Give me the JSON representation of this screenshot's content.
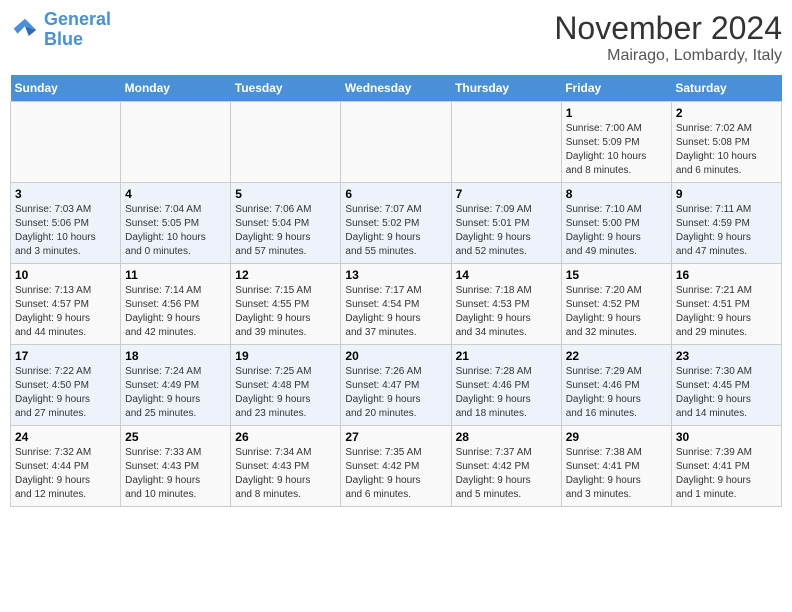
{
  "header": {
    "logo_line1": "General",
    "logo_line2": "Blue",
    "title": "November 2024",
    "subtitle": "Mairago, Lombardy, Italy"
  },
  "weekdays": [
    "Sunday",
    "Monday",
    "Tuesday",
    "Wednesday",
    "Thursday",
    "Friday",
    "Saturday"
  ],
  "weeks": [
    [
      {
        "day": "",
        "info": ""
      },
      {
        "day": "",
        "info": ""
      },
      {
        "day": "",
        "info": ""
      },
      {
        "day": "",
        "info": ""
      },
      {
        "day": "",
        "info": ""
      },
      {
        "day": "1",
        "info": "Sunrise: 7:00 AM\nSunset: 5:09 PM\nDaylight: 10 hours\nand 8 minutes."
      },
      {
        "day": "2",
        "info": "Sunrise: 7:02 AM\nSunset: 5:08 PM\nDaylight: 10 hours\nand 6 minutes."
      }
    ],
    [
      {
        "day": "3",
        "info": "Sunrise: 7:03 AM\nSunset: 5:06 PM\nDaylight: 10 hours\nand 3 minutes."
      },
      {
        "day": "4",
        "info": "Sunrise: 7:04 AM\nSunset: 5:05 PM\nDaylight: 10 hours\nand 0 minutes."
      },
      {
        "day": "5",
        "info": "Sunrise: 7:06 AM\nSunset: 5:04 PM\nDaylight: 9 hours\nand 57 minutes."
      },
      {
        "day": "6",
        "info": "Sunrise: 7:07 AM\nSunset: 5:02 PM\nDaylight: 9 hours\nand 55 minutes."
      },
      {
        "day": "7",
        "info": "Sunrise: 7:09 AM\nSunset: 5:01 PM\nDaylight: 9 hours\nand 52 minutes."
      },
      {
        "day": "8",
        "info": "Sunrise: 7:10 AM\nSunset: 5:00 PM\nDaylight: 9 hours\nand 49 minutes."
      },
      {
        "day": "9",
        "info": "Sunrise: 7:11 AM\nSunset: 4:59 PM\nDaylight: 9 hours\nand 47 minutes."
      }
    ],
    [
      {
        "day": "10",
        "info": "Sunrise: 7:13 AM\nSunset: 4:57 PM\nDaylight: 9 hours\nand 44 minutes."
      },
      {
        "day": "11",
        "info": "Sunrise: 7:14 AM\nSunset: 4:56 PM\nDaylight: 9 hours\nand 42 minutes."
      },
      {
        "day": "12",
        "info": "Sunrise: 7:15 AM\nSunset: 4:55 PM\nDaylight: 9 hours\nand 39 minutes."
      },
      {
        "day": "13",
        "info": "Sunrise: 7:17 AM\nSunset: 4:54 PM\nDaylight: 9 hours\nand 37 minutes."
      },
      {
        "day": "14",
        "info": "Sunrise: 7:18 AM\nSunset: 4:53 PM\nDaylight: 9 hours\nand 34 minutes."
      },
      {
        "day": "15",
        "info": "Sunrise: 7:20 AM\nSunset: 4:52 PM\nDaylight: 9 hours\nand 32 minutes."
      },
      {
        "day": "16",
        "info": "Sunrise: 7:21 AM\nSunset: 4:51 PM\nDaylight: 9 hours\nand 29 minutes."
      }
    ],
    [
      {
        "day": "17",
        "info": "Sunrise: 7:22 AM\nSunset: 4:50 PM\nDaylight: 9 hours\nand 27 minutes."
      },
      {
        "day": "18",
        "info": "Sunrise: 7:24 AM\nSunset: 4:49 PM\nDaylight: 9 hours\nand 25 minutes."
      },
      {
        "day": "19",
        "info": "Sunrise: 7:25 AM\nSunset: 4:48 PM\nDaylight: 9 hours\nand 23 minutes."
      },
      {
        "day": "20",
        "info": "Sunrise: 7:26 AM\nSunset: 4:47 PM\nDaylight: 9 hours\nand 20 minutes."
      },
      {
        "day": "21",
        "info": "Sunrise: 7:28 AM\nSunset: 4:46 PM\nDaylight: 9 hours\nand 18 minutes."
      },
      {
        "day": "22",
        "info": "Sunrise: 7:29 AM\nSunset: 4:46 PM\nDaylight: 9 hours\nand 16 minutes."
      },
      {
        "day": "23",
        "info": "Sunrise: 7:30 AM\nSunset: 4:45 PM\nDaylight: 9 hours\nand 14 minutes."
      }
    ],
    [
      {
        "day": "24",
        "info": "Sunrise: 7:32 AM\nSunset: 4:44 PM\nDaylight: 9 hours\nand 12 minutes."
      },
      {
        "day": "25",
        "info": "Sunrise: 7:33 AM\nSunset: 4:43 PM\nDaylight: 9 hours\nand 10 minutes."
      },
      {
        "day": "26",
        "info": "Sunrise: 7:34 AM\nSunset: 4:43 PM\nDaylight: 9 hours\nand 8 minutes."
      },
      {
        "day": "27",
        "info": "Sunrise: 7:35 AM\nSunset: 4:42 PM\nDaylight: 9 hours\nand 6 minutes."
      },
      {
        "day": "28",
        "info": "Sunrise: 7:37 AM\nSunset: 4:42 PM\nDaylight: 9 hours\nand 5 minutes."
      },
      {
        "day": "29",
        "info": "Sunrise: 7:38 AM\nSunset: 4:41 PM\nDaylight: 9 hours\nand 3 minutes."
      },
      {
        "day": "30",
        "info": "Sunrise: 7:39 AM\nSunset: 4:41 PM\nDaylight: 9 hours\nand 1 minute."
      }
    ]
  ]
}
